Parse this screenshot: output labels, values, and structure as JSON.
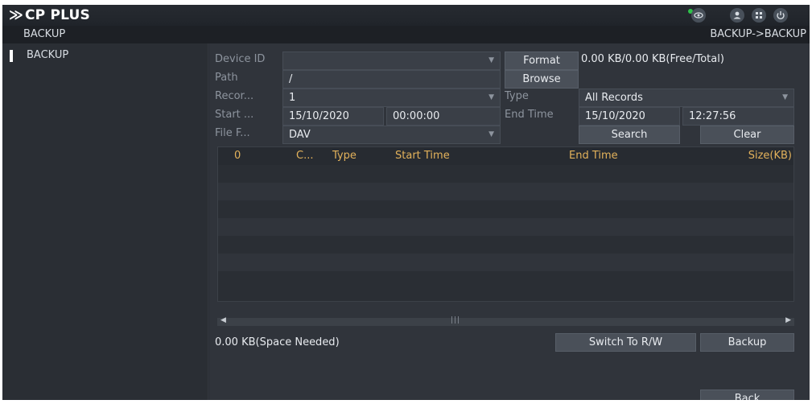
{
  "app": {
    "logo_text": "CP PLUS",
    "logo_mark": "≫",
    "top_icons": [
      "live-view-icon",
      "user-icon",
      "grid-menu-icon",
      "power-icon"
    ],
    "status_color": "#2ec24a"
  },
  "breadcrumb": {
    "left": "BACKUP",
    "right": "BACKUP->BACKUP"
  },
  "sidebar": {
    "items": [
      {
        "label": "BACKUP",
        "active": true
      }
    ]
  },
  "form": {
    "device_id": {
      "label": "Device ID",
      "value": ""
    },
    "format_button": "Format",
    "storage_info": "0.00 KB/0.00 KB(Free/Total)",
    "path": {
      "label": "Path",
      "value": "/"
    },
    "browse_button": "Browse",
    "record": {
      "label": "Recor...",
      "value": "1"
    },
    "type": {
      "label": "Type",
      "value": "All Records"
    },
    "start": {
      "label": "Start ...",
      "date": "15/10/2020",
      "time": "00:00:00"
    },
    "end": {
      "label": "End Time",
      "date": "15/10/2020",
      "time": "12:27:56"
    },
    "file_format": {
      "label": "File F...",
      "value": "DAV"
    },
    "search_button": "Search",
    "clear_button": "Clear"
  },
  "table": {
    "columns": [
      "0",
      "C...",
      "Type",
      "Start Time",
      "End Time",
      "Size(KB)"
    ],
    "rows": []
  },
  "footer": {
    "space_needed": "0.00 KB(Space Needed)",
    "switch_button": "Switch To R/W",
    "backup_button": "Backup",
    "back_button": "Back"
  },
  "colors": {
    "panel": "#30343b",
    "header_text": "#e3b25b",
    "button": "#4a5059"
  }
}
